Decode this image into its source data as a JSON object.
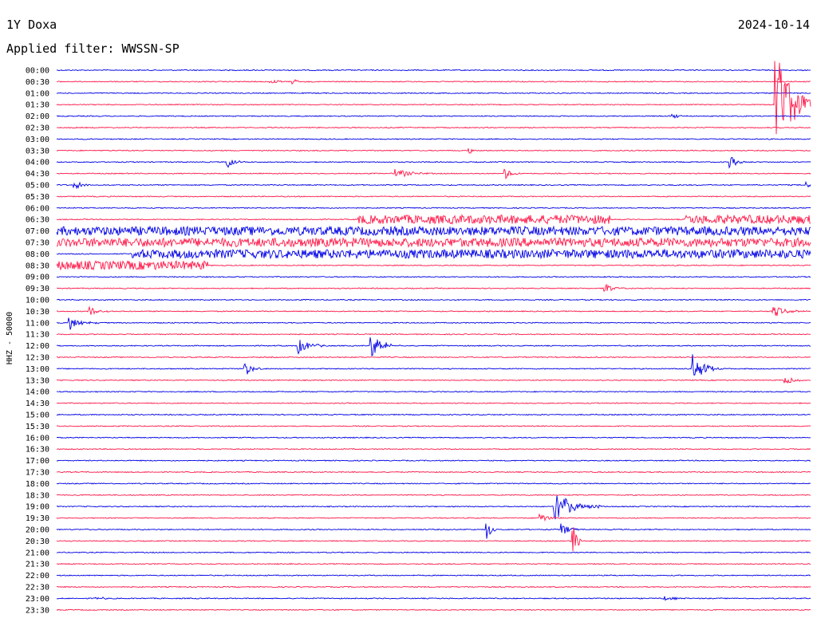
{
  "header": {
    "station": "1Y Doxa",
    "date": "2024-10-14",
    "filter": "Applied filter: WWSSN-SP"
  },
  "chart_data": {
    "type": "helicorder",
    "ylabel": "HHZ - 50000",
    "colors": {
      "odd": "#0000e6",
      "even": "#ff1a4a"
    },
    "rows": [
      "00:00",
      "00:30",
      "01:00",
      "01:30",
      "02:00",
      "02:30",
      "03:00",
      "03:30",
      "04:00",
      "04:30",
      "05:00",
      "05:30",
      "06:00",
      "06:30",
      "07:00",
      "07:30",
      "08:00",
      "08:30",
      "09:00",
      "09:30",
      "10:00",
      "10:30",
      "11:00",
      "11:30",
      "12:00",
      "12:30",
      "13:00",
      "13:30",
      "14:00",
      "14:30",
      "15:00",
      "15:30",
      "16:00",
      "16:30",
      "17:00",
      "17:30",
      "18:00",
      "18:30",
      "19:00",
      "19:30",
      "20:00",
      "20:30",
      "21:00",
      "21:30",
      "22:00",
      "22:30",
      "23:00",
      "23:30"
    ],
    "noisy_rows": [
      {
        "row": "06:30",
        "minutes": [
          [
            12,
            14
          ],
          [
            13,
            22
          ],
          [
            25,
            30
          ]
        ]
      },
      {
        "row": "07:00",
        "minutes": [
          [
            0,
            30
          ]
        ]
      },
      {
        "row": "07:30",
        "minutes": [
          [
            0,
            30
          ]
        ]
      },
      {
        "row": "08:00",
        "minutes": [
          [
            3,
            30
          ]
        ]
      },
      {
        "row": "08:30",
        "minutes": [
          [
            0,
            6
          ],
          [
            4,
            6
          ]
        ]
      }
    ],
    "events": [
      {
        "row": "00:30",
        "minute": 8.5,
        "amp": 4,
        "dur": 0.6
      },
      {
        "row": "00:30",
        "minute": 9.4,
        "amp": 4,
        "dur": 0.6
      },
      {
        "row": "00:30",
        "minute": 15.8,
        "amp": 2,
        "dur": 0.4
      },
      {
        "row": "01:30",
        "minute": 28.6,
        "amp": 70,
        "dur": 1.8
      },
      {
        "row": "02:00",
        "minute": 24.5,
        "amp": 3,
        "dur": 0.8
      },
      {
        "row": "03:30",
        "minute": 16.4,
        "amp": 5,
        "dur": 0.4
      },
      {
        "row": "04:00",
        "minute": 6.8,
        "amp": 8,
        "dur": 0.7
      },
      {
        "row": "04:00",
        "minute": 26.8,
        "amp": 8,
        "dur": 0.7
      },
      {
        "row": "04:30",
        "minute": 13.5,
        "amp": 6,
        "dur": 1.5
      },
      {
        "row": "04:30",
        "minute": 17.8,
        "amp": 8,
        "dur": 0.8
      },
      {
        "row": "05:00",
        "minute": 0.7,
        "amp": 5,
        "dur": 1.0
      },
      {
        "row": "05:00",
        "minute": 29.8,
        "amp": 4,
        "dur": 0.9
      },
      {
        "row": "09:30",
        "minute": 21.8,
        "amp": 6,
        "dur": 0.9
      },
      {
        "row": "10:30",
        "minute": 1.3,
        "amp": 6,
        "dur": 1.0
      },
      {
        "row": "10:30",
        "minute": 28.5,
        "amp": 8,
        "dur": 1.3
      },
      {
        "row": "11:00",
        "minute": 0.5,
        "amp": 9,
        "dur": 1.2
      },
      {
        "row": "12:00",
        "minute": 9.6,
        "amp": 10,
        "dur": 1.2
      },
      {
        "row": "12:00",
        "minute": 12.5,
        "amp": 16,
        "dur": 1.2
      },
      {
        "row": "13:00",
        "minute": 7.5,
        "amp": 10,
        "dur": 0.8
      },
      {
        "row": "13:00",
        "minute": 25.3,
        "amp": 18,
        "dur": 1.2
      },
      {
        "row": "13:30",
        "minute": 29.0,
        "amp": 5,
        "dur": 0.9
      },
      {
        "row": "19:00",
        "minute": 19.8,
        "amp": 18,
        "dur": 2.0
      },
      {
        "row": "19:30",
        "minute": 19.2,
        "amp": 6,
        "dur": 1.0
      },
      {
        "row": "20:00",
        "minute": 17.1,
        "amp": 18,
        "dur": 0.4
      },
      {
        "row": "20:00",
        "minute": 20.1,
        "amp": 8,
        "dur": 0.8
      },
      {
        "row": "20:30",
        "minute": 20.5,
        "amp": 28,
        "dur": 0.5
      },
      {
        "row": "23:00",
        "minute": 1.6,
        "amp": 3,
        "dur": 0.7
      },
      {
        "row": "23:00",
        "minute": 24.2,
        "amp": 3,
        "dur": 1.0
      }
    ]
  }
}
